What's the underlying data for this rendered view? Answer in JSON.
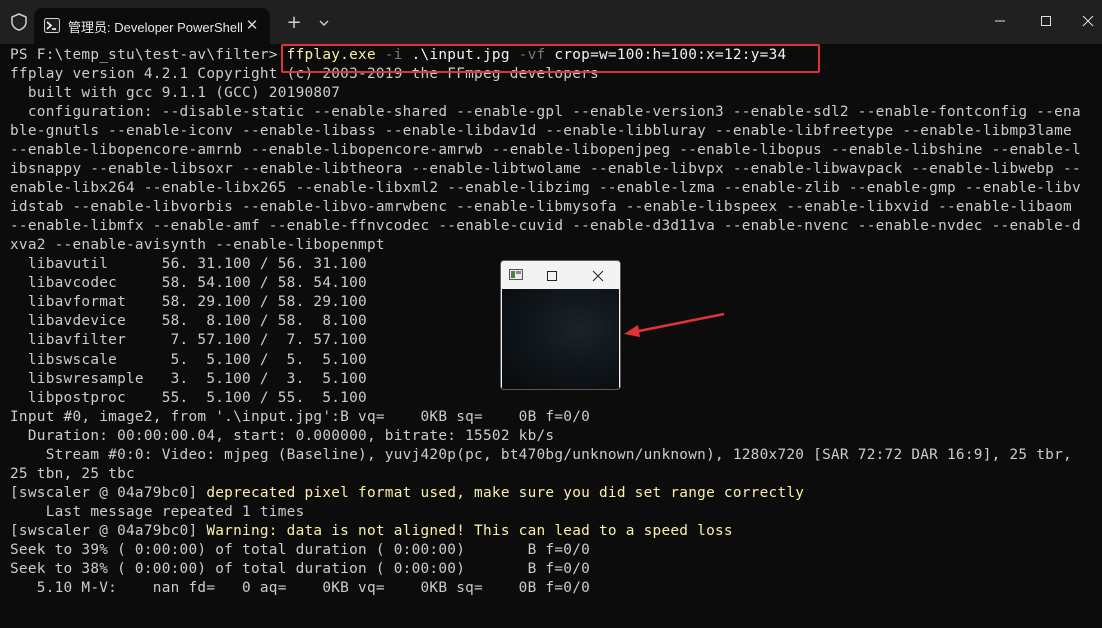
{
  "titlebar": {
    "tab_title": "管理员: Developer PowerShell",
    "new_tab_label": "+",
    "close_tab_label": "✕"
  },
  "console": {
    "lines": [
      {
        "parts": [
          {
            "text": "PS F:\\temp_stu\\test-av\\filter> ",
            "cls": "cyan"
          },
          {
            "text": "ffplay.exe",
            "cls": "yellow"
          },
          {
            "text": " -i",
            "cls": "gray"
          },
          {
            "text": " .\\input.jpg",
            "cls": "white"
          },
          {
            "text": " -vf",
            "cls": "gray"
          },
          {
            "text": " crop=w=100:h=100:x=12:y=34",
            "cls": "white"
          }
        ]
      },
      {
        "parts": [
          {
            "text": "ffplay version 4.2.1 Copyright (c) 2003-2019 the FFmpeg developers",
            "cls": ""
          }
        ]
      },
      {
        "parts": [
          {
            "text": "  built with gcc 9.1.1 (GCC) 20190807",
            "cls": ""
          }
        ]
      },
      {
        "parts": [
          {
            "text": "  configuration: --disable-static --enable-shared --enable-gpl --enable-version3 --enable-sdl2 --enable-fontconfig --ena",
            "cls": ""
          }
        ]
      },
      {
        "parts": [
          {
            "text": "ble-gnutls --enable-iconv --enable-libass --enable-libdav1d --enable-libbluray --enable-libfreetype --enable-libmp3lame",
            "cls": ""
          }
        ]
      },
      {
        "parts": [
          {
            "text": "--enable-libopencore-amrnb --enable-libopencore-amrwb --enable-libopenjpeg --enable-libopus --enable-libshine --enable-l",
            "cls": ""
          }
        ]
      },
      {
        "parts": [
          {
            "text": "ibsnappy --enable-libsoxr --enable-libtheora --enable-libtwolame --enable-libvpx --enable-libwavpack --enable-libwebp --",
            "cls": ""
          }
        ]
      },
      {
        "parts": [
          {
            "text": "enable-libx264 --enable-libx265 --enable-libxml2 --enable-libzimg --enable-lzma --enable-zlib --enable-gmp --enable-libv",
            "cls": ""
          }
        ]
      },
      {
        "parts": [
          {
            "text": "idstab --enable-libvorbis --enable-libvo-amrwbenc --enable-libmysofa --enable-libspeex --enable-libxvid --enable-libaom",
            "cls": ""
          }
        ]
      },
      {
        "parts": [
          {
            "text": "--enable-libmfx --enable-amf --enable-ffnvcodec --enable-cuvid --enable-d3d11va --enable-nvenc --enable-nvdec --enable-d",
            "cls": ""
          }
        ]
      },
      {
        "parts": [
          {
            "text": "xva2 --enable-avisynth --enable-libopenmpt",
            "cls": ""
          }
        ]
      },
      {
        "parts": [
          {
            "text": "  libavutil      56. 31.100 / 56. 31.100",
            "cls": ""
          }
        ]
      },
      {
        "parts": [
          {
            "text": "  libavcodec     58. 54.100 / 58. 54.100",
            "cls": ""
          }
        ]
      },
      {
        "parts": [
          {
            "text": "  libavformat    58. 29.100 / 58. 29.100",
            "cls": ""
          }
        ]
      },
      {
        "parts": [
          {
            "text": "  libavdevice    58.  8.100 / 58.  8.100",
            "cls": ""
          }
        ]
      },
      {
        "parts": [
          {
            "text": "  libavfilter     7. 57.100 /  7. 57.100",
            "cls": ""
          }
        ]
      },
      {
        "parts": [
          {
            "text": "  libswscale      5.  5.100 /  5.  5.100",
            "cls": ""
          }
        ]
      },
      {
        "parts": [
          {
            "text": "  libswresample   3.  5.100 /  3.  5.100",
            "cls": ""
          }
        ]
      },
      {
        "parts": [
          {
            "text": "  libpostproc    55.  5.100 / 55.  5.100",
            "cls": ""
          }
        ]
      },
      {
        "parts": [
          {
            "text": "Input #0, image2, from '.\\input.jpg':B vq=    0KB sq=    0B f=0/0",
            "cls": ""
          }
        ]
      },
      {
        "parts": [
          {
            "text": "  Duration: 00:00:00.04, start: 0.000000, bitrate: 15502 kb/s",
            "cls": ""
          }
        ]
      },
      {
        "parts": [
          {
            "text": "    Stream #0:0: Video: mjpeg (Baseline), yuvj420p(pc, bt470bg/unknown/unknown), 1280x720 [SAR 72:72 DAR 16:9], 25 tbr,",
            "cls": ""
          }
        ]
      },
      {
        "parts": [
          {
            "text": "25 tbn, 25 tbc",
            "cls": ""
          }
        ]
      },
      {
        "parts": [
          {
            "text": "[swscaler @ 04a79bc0] ",
            "cls": ""
          },
          {
            "text": "deprecated pixel format used, make sure you did set range correctly",
            "cls": "yellow"
          }
        ]
      },
      {
        "parts": [
          {
            "text": "    Last message repeated 1 times",
            "cls": ""
          }
        ]
      },
      {
        "parts": [
          {
            "text": "[swscaler @ 04a79bc0] ",
            "cls": ""
          },
          {
            "text": "Warning: data is not aligned! This can lead to a speed loss",
            "cls": "yellow"
          }
        ]
      },
      {
        "parts": [
          {
            "text": "Seek to 39% ( 0:00:00) of total duration ( 0:00:00)       B f=0/0",
            "cls": ""
          }
        ]
      },
      {
        "parts": [
          {
            "text": "Seek to 38% ( 0:00:00) of total duration ( 0:00:00)       B f=0/0",
            "cls": ""
          }
        ]
      },
      {
        "parts": [
          {
            "text": "   5.10 M-V:    nan fd=   0 aq=    0KB vq=    0KB sq=    0B f=0/0",
            "cls": ""
          }
        ]
      }
    ]
  },
  "colors": {
    "highlight_border": "#e0323a",
    "arrow": "#e0323a",
    "yellow_text": "#f9f1a5"
  }
}
